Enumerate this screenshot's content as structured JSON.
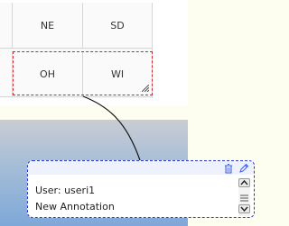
{
  "grid": {
    "cells": {
      "ne": "NE",
      "sd": "SD",
      "oh": "OH",
      "wi": "WI"
    }
  },
  "annotation": {
    "user_line": "User: useri1",
    "text": "New Annotation",
    "delete_icon": "trash-icon",
    "edit_icon": "pencil-icon"
  }
}
